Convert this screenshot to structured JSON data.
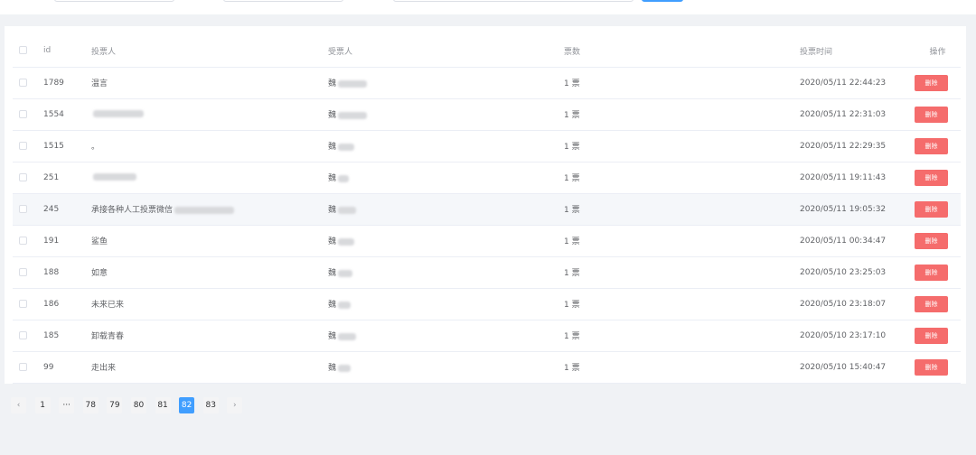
{
  "table": {
    "headers": {
      "id": "id",
      "voter": "投票人",
      "votee": "受票人",
      "votes": "票数",
      "time": "投票时间",
      "op": "操作"
    },
    "delete_label": "删除",
    "rows": [
      {
        "id": "1789",
        "voter": "温言",
        "votee": "魏",
        "votes": "1 票",
        "time": "2020/05/11 22:44:23"
      },
      {
        "id": "1554",
        "voter": "",
        "votee": "魏",
        "votes": "1 票",
        "time": "2020/05/11 22:31:03"
      },
      {
        "id": "1515",
        "voter": "。",
        "votee": "魏",
        "votes": "1 票",
        "time": "2020/05/11 22:29:35"
      },
      {
        "id": "251",
        "voter": "",
        "votee": "魏",
        "votes": "1 票",
        "time": "2020/05/11 19:11:43"
      },
      {
        "id": "245",
        "voter": "承接各种人工投票微信",
        "votee": "魏",
        "votes": "1 票",
        "time": "2020/05/11 19:05:32"
      },
      {
        "id": "191",
        "voter": "鲨鱼",
        "votee": "魏",
        "votes": "1 票",
        "time": "2020/05/11 00:34:47"
      },
      {
        "id": "188",
        "voter": "如意",
        "votee": "魏",
        "votes": "1 票",
        "time": "2020/05/10 23:25:03"
      },
      {
        "id": "186",
        "voter": "未来已来",
        "votee": "魏",
        "votes": "1 票",
        "time": "2020/05/10 23:18:07"
      },
      {
        "id": "185",
        "voter": "卸载青春",
        "votee": "魏",
        "votes": "1 票",
        "time": "2020/05/10 23:17:10"
      },
      {
        "id": "99",
        "voter": "走出来",
        "votee": "魏",
        "votes": "1 票",
        "time": "2020/05/10 15:40:47"
      }
    ]
  },
  "pagination": {
    "prev": "‹",
    "pages": [
      "1",
      "···",
      "78",
      "79",
      "80",
      "81",
      "82",
      "83"
    ],
    "current": "82",
    "next": "›"
  }
}
